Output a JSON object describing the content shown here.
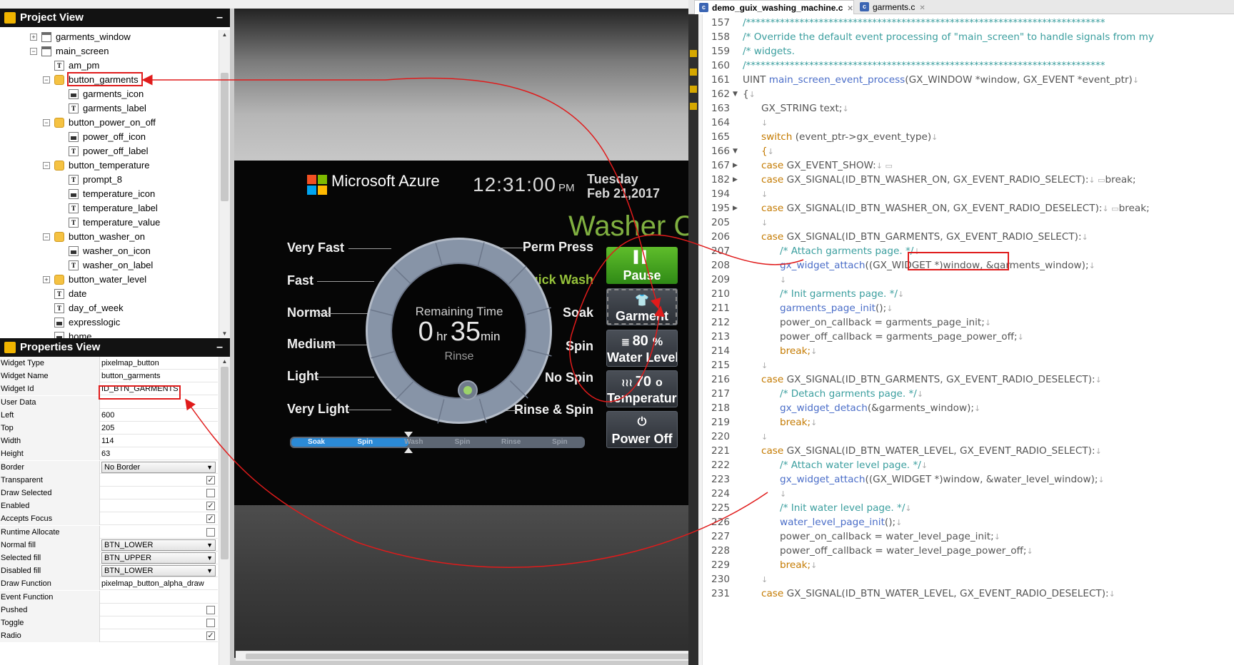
{
  "project_view": {
    "title": "Project View",
    "tree": [
      {
        "label": "garments_window",
        "icon": "window",
        "level": 1,
        "expander": "+"
      },
      {
        "label": "main_screen",
        "icon": "window",
        "level": 1,
        "expander": "-"
      },
      {
        "label": "am_pm",
        "icon": "text",
        "level": 2,
        "expander": ""
      },
      {
        "label": "button_garments",
        "icon": "button",
        "level": 2,
        "expander": "-"
      },
      {
        "label": "garments_icon",
        "icon": "image",
        "level": 3,
        "expander": ""
      },
      {
        "label": "garments_label",
        "icon": "text",
        "level": 3,
        "expander": ""
      },
      {
        "label": "button_power_on_off",
        "icon": "button",
        "level": 2,
        "expander": "-"
      },
      {
        "label": "power_off_icon",
        "icon": "image",
        "level": 3,
        "expander": ""
      },
      {
        "label": "power_off_label",
        "icon": "text",
        "level": 3,
        "expander": ""
      },
      {
        "label": "button_temperature",
        "icon": "button",
        "level": 2,
        "expander": "-"
      },
      {
        "label": "prompt_8",
        "icon": "text",
        "level": 3,
        "expander": ""
      },
      {
        "label": "temperature_icon",
        "icon": "image",
        "level": 3,
        "expander": ""
      },
      {
        "label": "temperature_label",
        "icon": "text",
        "level": 3,
        "expander": ""
      },
      {
        "label": "temperature_value",
        "icon": "text",
        "level": 3,
        "expander": ""
      },
      {
        "label": "button_washer_on",
        "icon": "button",
        "level": 2,
        "expander": "-"
      },
      {
        "label": "washer_on_icon",
        "icon": "image",
        "level": 3,
        "expander": ""
      },
      {
        "label": "washer_on_label",
        "icon": "text",
        "level": 3,
        "expander": ""
      },
      {
        "label": "button_water_level",
        "icon": "button",
        "level": 2,
        "expander": "+"
      },
      {
        "label": "date",
        "icon": "text",
        "level": 2,
        "expander": ""
      },
      {
        "label": "day_of_week",
        "icon": "text",
        "level": 2,
        "expander": ""
      },
      {
        "label": "expresslogic",
        "icon": "image",
        "level": 2,
        "expander": ""
      },
      {
        "label": "home",
        "icon": "image",
        "level": 2,
        "expander": ""
      }
    ]
  },
  "properties_view": {
    "title": "Properties View",
    "rows": [
      {
        "label": "Widget Type",
        "value": "pixelmap_button",
        "kind": "text"
      },
      {
        "label": "Widget Name",
        "value": "button_garments",
        "kind": "text"
      },
      {
        "label": "Widget Id",
        "value": "ID_BTN_GARMENTS",
        "kind": "text"
      },
      {
        "label": "User Data",
        "value": "",
        "kind": "text"
      },
      {
        "label": "Left",
        "value": "600",
        "kind": "text"
      },
      {
        "label": "Top",
        "value": "205",
        "kind": "text"
      },
      {
        "label": "Width",
        "value": "114",
        "kind": "text"
      },
      {
        "label": "Height",
        "value": "63",
        "kind": "text"
      },
      {
        "label": "Border",
        "value": "No Border",
        "kind": "select"
      },
      {
        "label": "Transparent",
        "value": "",
        "kind": "check",
        "checked": true
      },
      {
        "label": "Draw Selected",
        "value": "",
        "kind": "check",
        "checked": false
      },
      {
        "label": "Enabled",
        "value": "",
        "kind": "check",
        "checked": true
      },
      {
        "label": "Accepts Focus",
        "value": "",
        "kind": "check",
        "checked": true
      },
      {
        "label": "Runtime Allocate",
        "value": "",
        "kind": "check",
        "checked": false
      },
      {
        "label": "Normal fill",
        "value": "BTN_LOWER",
        "kind": "select"
      },
      {
        "label": "Selected fill",
        "value": "BTN_UPPER",
        "kind": "select"
      },
      {
        "label": "Disabled fill",
        "value": "BTN_LOWER",
        "kind": "select"
      },
      {
        "label": "Draw Function",
        "value": "pixelmap_button_alpha_draw",
        "kind": "text"
      },
      {
        "label": "Event Function",
        "value": "",
        "kind": "text"
      },
      {
        "label": "Pushed",
        "value": "",
        "kind": "check",
        "checked": false
      },
      {
        "label": "Toggle",
        "value": "",
        "kind": "check",
        "checked": false
      },
      {
        "label": "Radio",
        "value": "",
        "kind": "check",
        "checked": true
      }
    ]
  },
  "device": {
    "brand": "Microsoft Azure",
    "time": "12:31:00",
    "ampm": "PM",
    "day_of_week": "Tuesday",
    "date": "Feb 21,2017",
    "status": "Washer ON",
    "modes_left": [
      "Very Fast",
      "Fast",
      "Normal",
      "Medium",
      "Light",
      "Very Light"
    ],
    "modes_right": [
      "Perm Press",
      "Quick Wash",
      "Soak",
      "Spin",
      "No Spin",
      "Rinse & Spin"
    ],
    "active_mode": "Quick Wash",
    "dial": {
      "remaining_label": "Remaining Time",
      "hours": "0",
      "hr_unit": "hr",
      "minutes": "35",
      "min_unit": "min",
      "cycle": "Rinse"
    },
    "progress": {
      "segments": [
        "Soak",
        "Spin",
        "Wash",
        "Spin",
        "Rinse",
        "Spin"
      ],
      "fraction": 0.4
    },
    "side_buttons": [
      {
        "icon": "pause-icon",
        "glyph": "▌▌",
        "label": "Pause",
        "variant": "pause"
      },
      {
        "icon": "shirt-icon",
        "glyph": "👕",
        "label": "Garment",
        "variant": "gray-dashed"
      },
      {
        "icon": "water-level-icon",
        "glyph": "≣",
        "value": "80",
        "unit": "%",
        "label": "Water Level",
        "variant": "gray"
      },
      {
        "icon": "temperature-icon",
        "glyph": "≀≀≀",
        "value": "70",
        "unit": "o",
        "label": "Temperature",
        "variant": "gray"
      },
      {
        "icon": "power-icon",
        "glyph": "⏻",
        "label": "Power Off",
        "variant": "gray"
      }
    ]
  },
  "editor": {
    "tabs": [
      {
        "label": "demo_guix_washing_machine.c",
        "active": true
      },
      {
        "label": "garments.c",
        "active": false
      }
    ],
    "lines": [
      {
        "n": "157",
        "fold": "",
        "indent": 0,
        "parts": [
          [
            "c",
            "/**************************************************************************"
          ]
        ]
      },
      {
        "n": "158",
        "fold": "",
        "indent": 0,
        "parts": [
          [
            "c",
            "/* Override the default event processing of \"main_screen\" to handle signals from my"
          ]
        ]
      },
      {
        "n": "159",
        "fold": "",
        "indent": 0,
        "parts": [
          [
            "c",
            "/* widgets."
          ]
        ]
      },
      {
        "n": "160",
        "fold": "",
        "indent": 0,
        "parts": [
          [
            "c",
            "/**************************************************************************"
          ]
        ]
      },
      {
        "n": "161",
        "fold": "",
        "indent": 0,
        "parts": [
          [
            "t",
            "UINT "
          ],
          [
            "f",
            "main_screen_event_process"
          ],
          [
            "t",
            "(GX_WINDOW *window, GX_EVENT *event_ptr)"
          ],
          [
            "r",
            "↓"
          ]
        ]
      },
      {
        "n": "162",
        "fold": "▼",
        "indent": 0,
        "parts": [
          [
            "t",
            "{"
          ],
          [
            "r",
            "↓"
          ]
        ]
      },
      {
        "n": "163",
        "fold": "",
        "indent": 1,
        "parts": [
          [
            "t",
            "GX_STRING text;"
          ],
          [
            "r",
            "↓"
          ]
        ]
      },
      {
        "n": "164",
        "fold": "",
        "indent": 1,
        "parts": [
          [
            "r",
            "↓"
          ]
        ]
      },
      {
        "n": "165",
        "fold": "",
        "indent": 1,
        "parts": [
          [
            "k",
            "switch "
          ],
          [
            "t",
            "(event_ptr->gx_event_type)"
          ],
          [
            "r",
            "↓"
          ]
        ]
      },
      {
        "n": "166",
        "fold": "▼",
        "indent": 1,
        "parts": [
          [
            "k",
            "{"
          ],
          [
            "r",
            "↓"
          ]
        ]
      },
      {
        "n": "167",
        "fold": "▶",
        "indent": 1,
        "parts": [
          [
            "k",
            "case "
          ],
          [
            "t",
            "GX_EVENT_SHOW:"
          ],
          [
            "r",
            "↓ ▭"
          ]
        ]
      },
      {
        "n": "182",
        "fold": "▶",
        "indent": 1,
        "parts": [
          [
            "k",
            "case "
          ],
          [
            "t",
            "GX_SIGNAL(ID_BTN_WASHER_ON, GX_EVENT_RADIO_SELECT):"
          ],
          [
            "r",
            "↓ ▭"
          ],
          [
            "t",
            "break;"
          ]
        ]
      },
      {
        "n": "194",
        "fold": "",
        "indent": 1,
        "parts": [
          [
            "r",
            "↓"
          ]
        ]
      },
      {
        "n": "195",
        "fold": "▶",
        "indent": 1,
        "parts": [
          [
            "k",
            "case "
          ],
          [
            "t",
            "GX_SIGNAL(ID_BTN_WASHER_ON, GX_EVENT_RADIO_DESELECT):"
          ],
          [
            "r",
            "↓ ▭"
          ],
          [
            "t",
            "break;"
          ]
        ]
      },
      {
        "n": "205",
        "fold": "",
        "indent": 1,
        "parts": [
          [
            "r",
            "↓"
          ]
        ]
      },
      {
        "n": "206",
        "fold": "",
        "indent": 1,
        "parts": [
          [
            "k",
            "case "
          ],
          [
            "t",
            "GX_SIGNAL(ID_BTN_GARMENTS, GX_EVENT_RADIO_SELECT):"
          ],
          [
            "r",
            "↓"
          ]
        ]
      },
      {
        "n": "207",
        "fold": "",
        "indent": 2,
        "parts": [
          [
            "c",
            "/* Attach garments page. */"
          ],
          [
            "r",
            "↓"
          ]
        ]
      },
      {
        "n": "208",
        "fold": "",
        "indent": 2,
        "parts": [
          [
            "f",
            "gx_widget_attach"
          ],
          [
            "t",
            "((GX_WIDGET *)window, &garments_window);"
          ],
          [
            "r",
            "↓"
          ]
        ]
      },
      {
        "n": "209",
        "fold": "",
        "indent": 2,
        "parts": [
          [
            "r",
            "↓"
          ]
        ]
      },
      {
        "n": "210",
        "fold": "",
        "indent": 2,
        "parts": [
          [
            "c",
            "/* Init garments page. */"
          ],
          [
            "r",
            "↓"
          ]
        ]
      },
      {
        "n": "211",
        "fold": "",
        "indent": 2,
        "parts": [
          [
            "f",
            "garments_page_init"
          ],
          [
            "t",
            "();"
          ],
          [
            "r",
            "↓"
          ]
        ]
      },
      {
        "n": "212",
        "fold": "",
        "indent": 2,
        "parts": [
          [
            "t",
            "power_on_callback = garments_page_init;"
          ],
          [
            "r",
            "↓"
          ]
        ]
      },
      {
        "n": "213",
        "fold": "",
        "indent": 2,
        "parts": [
          [
            "t",
            "power_off_callback = garments_page_power_off;"
          ],
          [
            "r",
            "↓"
          ]
        ]
      },
      {
        "n": "214",
        "fold": "",
        "indent": 2,
        "parts": [
          [
            "k",
            "break;"
          ],
          [
            "r",
            "↓"
          ]
        ]
      },
      {
        "n": "215",
        "fold": "",
        "indent": 1,
        "parts": [
          [
            "r",
            "↓"
          ]
        ]
      },
      {
        "n": "216",
        "fold": "",
        "indent": 1,
        "parts": [
          [
            "k",
            "case "
          ],
          [
            "t",
            "GX_SIGNAL(ID_BTN_GARMENTS, GX_EVENT_RADIO_DESELECT):"
          ],
          [
            "r",
            "↓"
          ]
        ]
      },
      {
        "n": "217",
        "fold": "",
        "indent": 2,
        "parts": [
          [
            "c",
            "/* Detach garments page. */"
          ],
          [
            "r",
            "↓"
          ]
        ]
      },
      {
        "n": "218",
        "fold": "",
        "indent": 2,
        "parts": [
          [
            "f",
            "gx_widget_detach"
          ],
          [
            "t",
            "(&garments_window);"
          ],
          [
            "r",
            "↓"
          ]
        ]
      },
      {
        "n": "219",
        "fold": "",
        "indent": 2,
        "parts": [
          [
            "k",
            "break;"
          ],
          [
            "r",
            "↓"
          ]
        ]
      },
      {
        "n": "220",
        "fold": "",
        "indent": 1,
        "parts": [
          [
            "r",
            "↓"
          ]
        ]
      },
      {
        "n": "221",
        "fold": "",
        "indent": 1,
        "parts": [
          [
            "k",
            "case "
          ],
          [
            "t",
            "GX_SIGNAL(ID_BTN_WATER_LEVEL, GX_EVENT_RADIO_SELECT):"
          ],
          [
            "r",
            "↓"
          ]
        ]
      },
      {
        "n": "222",
        "fold": "",
        "indent": 2,
        "parts": [
          [
            "c",
            "/* Attach water level page. */"
          ],
          [
            "r",
            "↓"
          ]
        ]
      },
      {
        "n": "223",
        "fold": "",
        "indent": 2,
        "parts": [
          [
            "f",
            "gx_widget_attach"
          ],
          [
            "t",
            "((GX_WIDGET *)window, &water_level_window);"
          ],
          [
            "r",
            "↓"
          ]
        ]
      },
      {
        "n": "224",
        "fold": "",
        "indent": 2,
        "parts": [
          [
            "r",
            "↓"
          ]
        ]
      },
      {
        "n": "225",
        "fold": "",
        "indent": 2,
        "parts": [
          [
            "c",
            "/* Init water level page. */"
          ],
          [
            "r",
            "↓"
          ]
        ]
      },
      {
        "n": "226",
        "fold": "",
        "indent": 2,
        "parts": [
          [
            "f",
            "water_level_page_init"
          ],
          [
            "t",
            "();"
          ],
          [
            "r",
            "↓"
          ]
        ]
      },
      {
        "n": "227",
        "fold": "",
        "indent": 2,
        "parts": [
          [
            "t",
            "power_on_callback = water_level_page_init;"
          ],
          [
            "r",
            "↓"
          ]
        ]
      },
      {
        "n": "228",
        "fold": "",
        "indent": 2,
        "parts": [
          [
            "t",
            "power_off_callback = water_level_page_power_off;"
          ],
          [
            "r",
            "↓"
          ]
        ]
      },
      {
        "n": "229",
        "fold": "",
        "indent": 2,
        "parts": [
          [
            "k",
            "break;"
          ],
          [
            "r",
            "↓"
          ]
        ]
      },
      {
        "n": "230",
        "fold": "",
        "indent": 1,
        "parts": [
          [
            "r",
            "↓"
          ]
        ]
      },
      {
        "n": "231",
        "fold": "",
        "indent": 1,
        "parts": [
          [
            "k",
            "case "
          ],
          [
            "t",
            "GX_SIGNAL(ID_BTN_WATER_LEVEL, GX_EVENT_RADIO_DESELECT):"
          ],
          [
            "r",
            "↓"
          ]
        ]
      }
    ]
  },
  "colors": {
    "annotation_red": "#e01b1b",
    "washer_on_green": "#80b040",
    "pause_green": "#3fa11e",
    "comment_teal": "#3a9e9e",
    "keyword_orange": "#c47a00",
    "function_blue": "#4a6dc8"
  }
}
